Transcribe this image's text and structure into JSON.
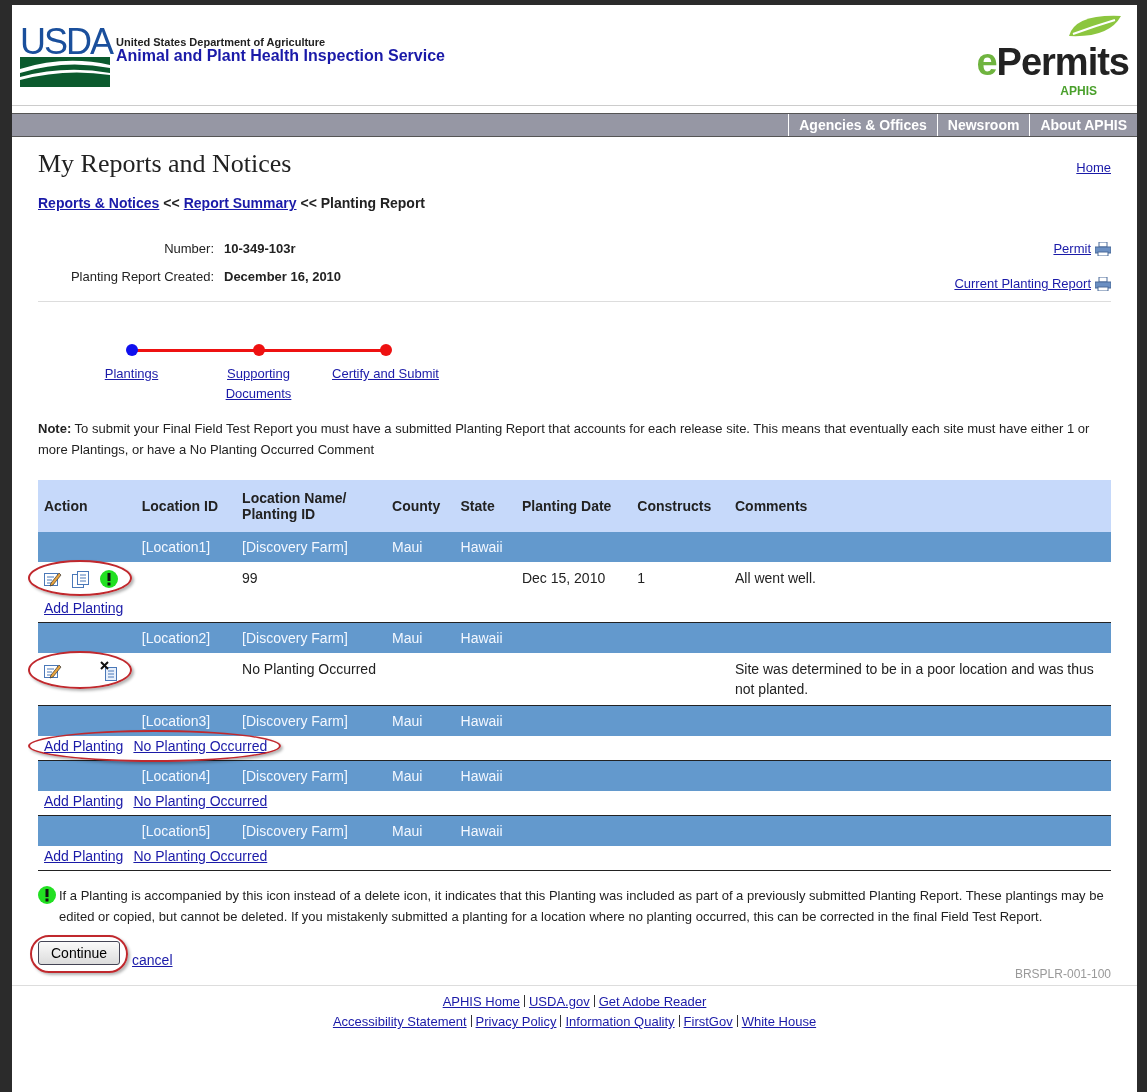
{
  "header": {
    "logo_text": "USDA",
    "department": "United States Department of Agriculture",
    "agency": "Animal and Plant Health Inspection Service",
    "app_logo_prefix": "e",
    "app_logo_rest": "Permits",
    "app_logo_sub": "APHIS"
  },
  "nav": [
    "Agencies & Offices",
    "Newsroom",
    "About APHIS"
  ],
  "page_title": "My Reports and Notices",
  "home_link": "Home",
  "breadcrumb": [
    {
      "text": "Reports & Notices",
      "kind": "link"
    },
    {
      "text": "<<",
      "kind": "sep"
    },
    {
      "text": "Report Summary",
      "kind": "link"
    },
    {
      "text": "<< Planting Report",
      "kind": "current"
    }
  ],
  "info": [
    {
      "label": "Number:",
      "value": "10-349-103r"
    },
    {
      "label": "Planting Report Created:",
      "value": "December 16, 2010"
    }
  ],
  "print_links": [
    "Permit",
    "Current Planting Report"
  ],
  "steps": [
    {
      "label": "Plantings",
      "selected": true
    },
    {
      "label": "Supporting Documents",
      "selected": false
    },
    {
      "label": "Certify and Submit",
      "selected": false
    }
  ],
  "note": "**Note:** To submit your Final Field Test Report you must have a submitted Planting Report that accounts for each release site. This means that eventually each site must have either 1 or more Plantings, or have a No Planting Occurred Comment",
  "table": {
    "columns": [
      "Action",
      "Location ID",
      "Location Name/ Planting ID",
      "County",
      "State",
      "Planting Date",
      "Constructs",
      "Comments"
    ],
    "locations": [
      {
        "location_id": "[Location1]",
        "location_name": "[Discovery Farm]",
        "county": "Maui",
        "state": "Hawaii",
        "entries": [
          {
            "actions": [
              {
                "kind": "edit"
              },
              {
                "kind": "copy"
              },
              {
                "kind": "submitted"
              }
            ],
            "highlighted": true,
            "planting_id": "99",
            "planting_date": "Dec 15, 2010",
            "constructs": "1",
            "comments": "All went well."
          }
        ],
        "links": [
          "Add Planting"
        ],
        "links_highlighted": false
      },
      {
        "location_id": "[Location2]",
        "location_name": "[Discovery Farm]",
        "county": "Maui",
        "state": "Hawaii",
        "entries": [
          {
            "actions": [
              {
                "kind": "edit"
              },
              {
                "kind": "spacer"
              },
              {
                "kind": "delete"
              }
            ],
            "highlighted": true,
            "planting_id": "No Planting Occurred",
            "comments": "Site was determined to be in a poor location and was thus not planted."
          }
        ]
      },
      {
        "location_id": "[Location3]",
        "location_name": "[Discovery Farm]",
        "county": "Maui",
        "state": "Hawaii",
        "links": [
          "Add Planting",
          "No Planting Occurred"
        ],
        "links_highlighted": true
      },
      {
        "location_id": "[Location4]",
        "location_name": "[Discovery Farm]",
        "county": "Maui",
        "state": "Hawaii",
        "links": [
          "Add Planting",
          "No Planting Occurred"
        ],
        "links_highlighted": false
      },
      {
        "location_id": "[Location5]",
        "location_name": "[Discovery Farm]",
        "county": "Maui",
        "state": "Hawaii",
        "links": [
          "Add Planting",
          "No Planting Occurred"
        ],
        "links_highlighted": false
      }
    ]
  },
  "legend": "If a Planting is accompanied by this icon instead of a delete icon, it indicates that this Planting was included as part of a previously submitted Planting Report. These plantings may be edited or copied, but cannot be deleted. If you mistakenly submitted a planting for a location where no planting occurred, this can be corrected in the final Field Test Report.",
  "continue_button": {
    "label": "Continue",
    "highlighted": true
  },
  "cancel_link": "cancel",
  "page_code": "BRSPLR-001-100",
  "footer": [
    [
      "APHIS Home",
      "USDA.gov",
      "Get Adobe Reader"
    ],
    [
      "Accessibility Statement",
      "Privacy Policy",
      "Information Quality",
      "FirstGov",
      "White House"
    ]
  ]
}
